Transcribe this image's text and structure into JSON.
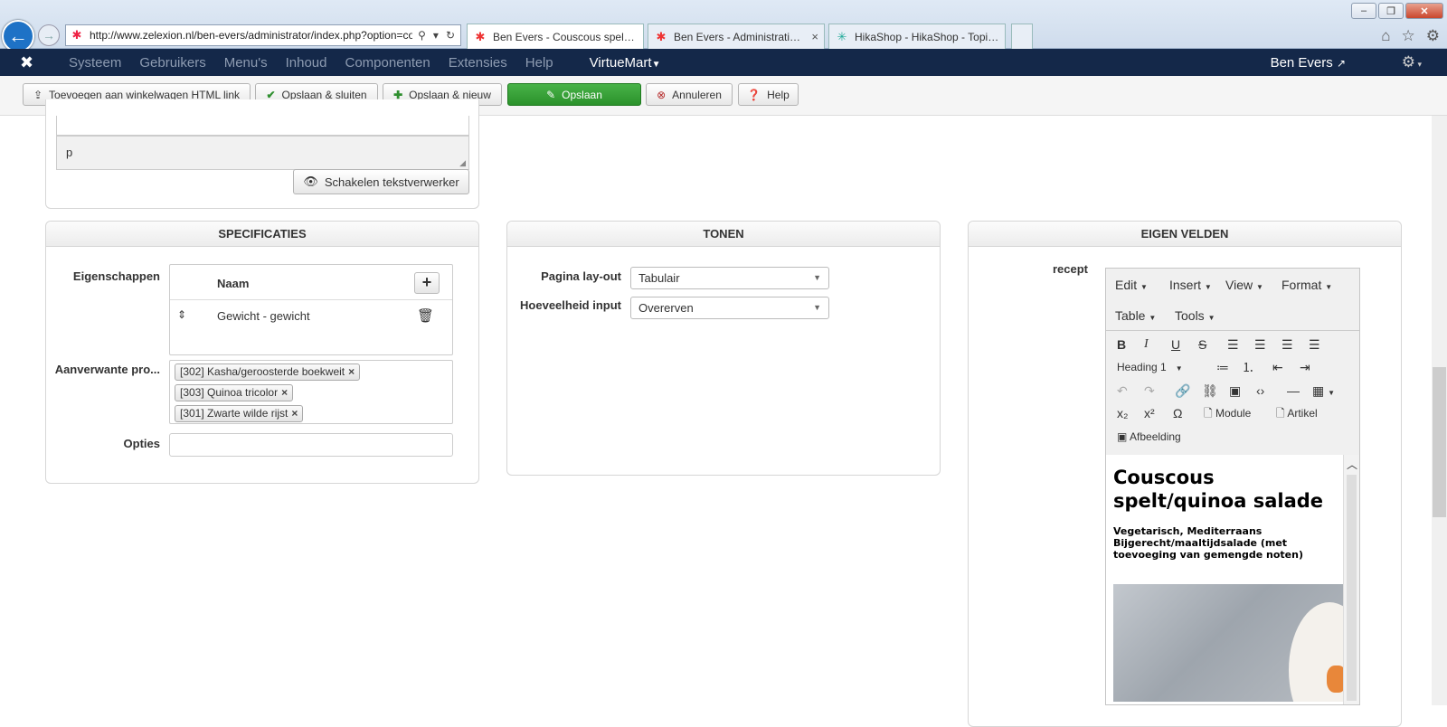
{
  "browser": {
    "address": "http://www.zelexion.nl/ben-evers/administrator/index.php?option=com_virtuemart",
    "tabs": [
      {
        "title": "Ben Evers - Couscous spelt / q..."
      },
      {
        "title": "Ben Evers - Administratie - ...",
        "close": "×"
      },
      {
        "title": "HikaShop - HikaShop - Topic: ..."
      }
    ],
    "window_buttons": [
      "‒",
      "❐",
      "✕"
    ]
  },
  "admin_menu": {
    "items": [
      "Systeem",
      "Gebruikers",
      "Menu's",
      "Inhoud",
      "Componenten",
      "Extensies",
      "Help"
    ],
    "virtuemart": "VirtueMart",
    "user": "Ben Evers"
  },
  "toolbar": {
    "add_cart_link": "Toevoegen aan winkelwagen HTML link",
    "save_close": "Opslaan & sluiten",
    "save_new": "Opslaan & nieuw",
    "save": "Opslaan",
    "cancel": "Annuleren",
    "help": "Help"
  },
  "top_editor": {
    "path": "p",
    "toggle_button": "Schakelen tekstverwerker"
  },
  "specificaties": {
    "title": "SPECIFICATIES",
    "eigenschappen_label": "Eigenschappen",
    "column_name": "Naam",
    "rows": [
      {
        "name": "Gewicht - gewicht"
      }
    ],
    "related_label": "Aanverwante pro...",
    "related_tags": [
      "[302] Kasha/geroosterde boekweit",
      "[303] Quinoa tricolor",
      "[301] Zwarte wilde rijst"
    ],
    "opties_label": "Opties",
    "opties_value": ""
  },
  "tonen": {
    "title": "TONEN",
    "layout_label": "Pagina lay-out",
    "layout_value": "Tabulair",
    "quantity_label": "Hoeveelheid input",
    "quantity_value": "Overerven"
  },
  "eigen_velden": {
    "title": "EIGEN VELDEN",
    "field_label": "recept",
    "menus": [
      "Edit",
      "Insert",
      "View",
      "Format",
      "Table",
      "Tools"
    ],
    "heading_select": "Heading 1",
    "module_button": "Module",
    "artikel_button": "Artikel",
    "afbeelding_button": "Afbeelding",
    "content_title": "Couscous spelt/quinoa salade",
    "content_subtitle": "Vegetarisch, Mediterraans Bijgerecht/maaltijdsalade (met toevoeging van gemengde noten)"
  }
}
